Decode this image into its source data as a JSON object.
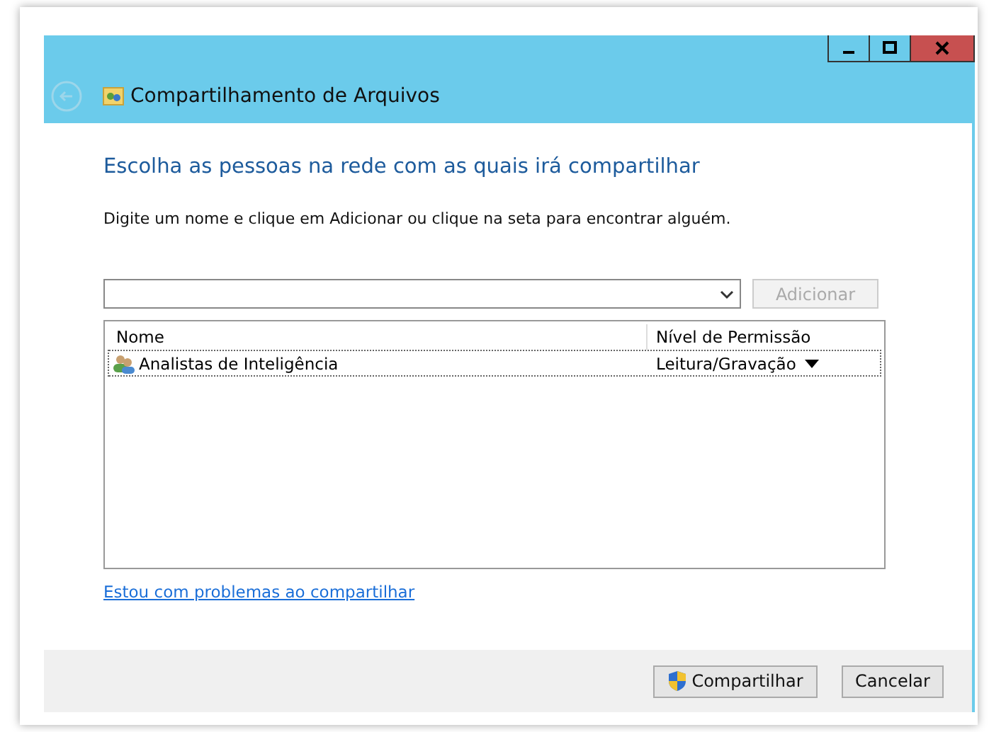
{
  "window": {
    "title": "Compartilhamento de Arquivos"
  },
  "heading": "Escolha as pessoas na rede com as quais irá compartilhar",
  "instruction": "Digite um nome e clique em Adicionar ou clique na seta para encontrar alguém.",
  "name_field": {
    "add_button": {
      "label": "Adicionar",
      "disabled": true
    }
  },
  "table": {
    "columns": [
      "Nome",
      "Nível de Permissão"
    ],
    "rows": [
      {
        "name": "Analistas de Inteligência",
        "permission": "Leitura/Gravação",
        "selected": true
      }
    ]
  },
  "help_link": "Estou com problemas ao compartilhar",
  "buttons": [
    {
      "label": "Compartilhar",
      "kind": "shield"
    },
    {
      "label": "Cancelar",
      "kind": "plain"
    }
  ]
}
